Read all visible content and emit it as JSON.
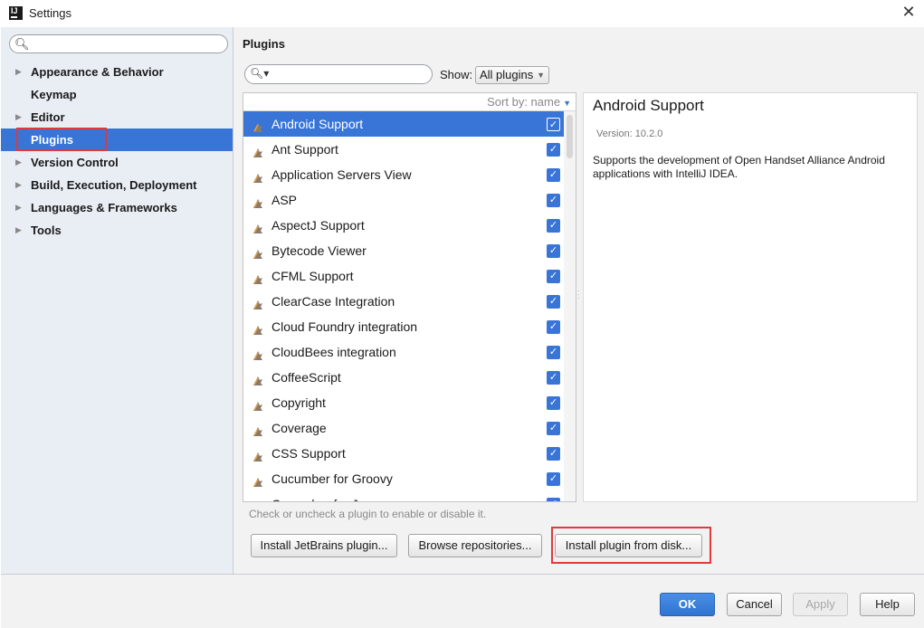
{
  "window": {
    "title": "Settings"
  },
  "sidebar": {
    "items": [
      {
        "label": "Appearance & Behavior",
        "expandable": true
      },
      {
        "label": "Keymap",
        "expandable": false
      },
      {
        "label": "Editor",
        "expandable": true
      },
      {
        "label": "Plugins",
        "expandable": false,
        "selected": true
      },
      {
        "label": "Version Control",
        "expandable": true
      },
      {
        "label": "Build, Execution, Deployment",
        "expandable": true
      },
      {
        "label": "Languages & Frameworks",
        "expandable": true
      },
      {
        "label": "Tools",
        "expandable": true
      }
    ]
  },
  "plugins": {
    "title": "Plugins",
    "show_label": "Show:",
    "show_value": "All plugins",
    "sort_label": "Sort by: name",
    "list": [
      {
        "name": "Android Support",
        "checked": true,
        "selected": true
      },
      {
        "name": "Ant Support",
        "checked": true
      },
      {
        "name": "Application Servers View",
        "checked": true
      },
      {
        "name": "ASP",
        "checked": true
      },
      {
        "name": "AspectJ Support",
        "checked": true
      },
      {
        "name": "Bytecode Viewer",
        "checked": true
      },
      {
        "name": "CFML Support",
        "checked": true
      },
      {
        "name": "ClearCase Integration",
        "checked": true
      },
      {
        "name": "Cloud Foundry integration",
        "checked": true
      },
      {
        "name": "CloudBees integration",
        "checked": true
      },
      {
        "name": "CoffeeScript",
        "checked": true
      },
      {
        "name": "Copyright",
        "checked": true
      },
      {
        "name": "Coverage",
        "checked": true
      },
      {
        "name": "CSS Support",
        "checked": true
      },
      {
        "name": "Cucumber for Groovy",
        "checked": true
      },
      {
        "name": "Cucumber for Java",
        "checked": true
      }
    ],
    "hint": "Check or uncheck a plugin to enable or disable it.",
    "buttons": {
      "install_jetbrains": "Install JetBrains plugin...",
      "browse": "Browse repositories...",
      "install_disk": "Install plugin from disk..."
    }
  },
  "detail": {
    "title": "Android Support",
    "version": "Version: 10.2.0",
    "description": "Supports the development of Open Handset Alliance Android applications with IntelliJ IDEA."
  },
  "footer": {
    "ok": "OK",
    "cancel": "Cancel",
    "apply": "Apply",
    "help": "Help"
  },
  "colors": {
    "selection": "#3875d7",
    "highlight_box": "#e03a3a"
  },
  "icons": {
    "close": "close-icon",
    "search": "search-icon",
    "plugin": "plugin-icon",
    "checkbox": "checkbox-checked-icon"
  }
}
